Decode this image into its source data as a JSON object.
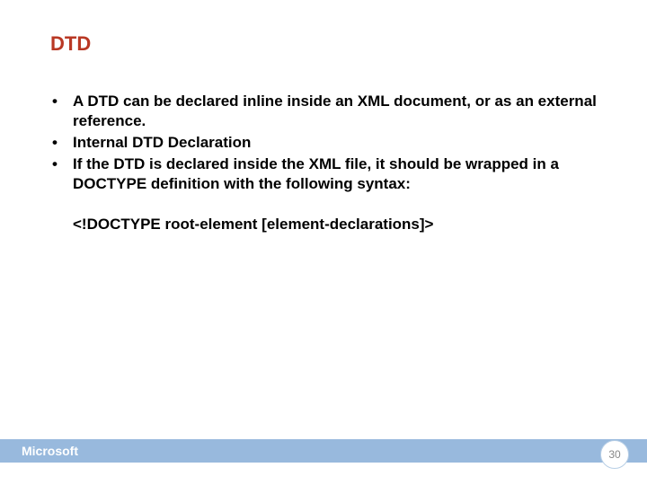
{
  "title": "DTD",
  "bullets": [
    "A DTD can be declared inline inside an XML document, or as an external reference.",
    "Internal DTD Declaration",
    "If the DTD is declared inside the XML file, it should be wrapped in a DOCTYPE definition with the following syntax:"
  ],
  "syntax": "<!DOCTYPE root-element [element-declarations]>",
  "footer_logo": "Microsoft",
  "page_number": "30",
  "bullet_marker": "•"
}
